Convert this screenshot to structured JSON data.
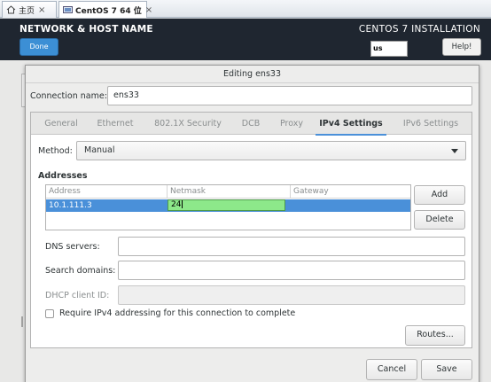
{
  "host_tabs": [
    {
      "label": "主页"
    },
    {
      "label": "CentOS 7 64 位"
    }
  ],
  "installer": {
    "spoke_title": "NETWORK & HOST NAME",
    "product_title": "CENTOS 7 INSTALLATION",
    "done_label": "Done",
    "keyboard_layout": "us",
    "help_label": "Help!"
  },
  "dialog": {
    "title": "Editing ens33",
    "connection_name_label": "Connection name:",
    "connection_name_value": "ens33",
    "tabs": [
      {
        "label": "General"
      },
      {
        "label": "Ethernet"
      },
      {
        "label": "802.1X Security"
      },
      {
        "label": "DCB"
      },
      {
        "label": "Proxy"
      },
      {
        "label": "IPv4 Settings",
        "active": true
      },
      {
        "label": "IPv6 Settings"
      }
    ],
    "method_label": "Method:",
    "method_value": "Manual",
    "addresses_heading": "Addresses",
    "address_columns": [
      "Address",
      "Netmask",
      "Gateway"
    ],
    "address_rows": [
      {
        "address": "10.1.111.3",
        "netmask": "24",
        "gateway": ""
      }
    ],
    "add_label": "Add",
    "delete_label": "Delete",
    "dns_label": "DNS servers:",
    "dns_value": "",
    "search_label": "Search domains:",
    "search_value": "",
    "dhcp_label": "DHCP client ID:",
    "dhcp_value": "",
    "require_label": "Require IPv4 addressing for this connection to complete",
    "require_checked": false,
    "routes_label": "Routes...",
    "cancel_label": "Cancel",
    "save_label": "Save"
  },
  "colors": {
    "accent": "#4a90d9",
    "edit_cell": "#8de88a",
    "header_bg": "#1f2630",
    "done_button": "#3c8fd5"
  }
}
